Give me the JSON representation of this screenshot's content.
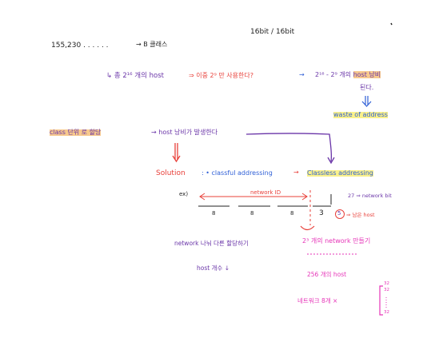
{
  "page": {
    "top_row": {
      "address": "155,230 . . . . . .",
      "b_class": "→ B 클래스",
      "bits": "16bit / 16bit"
    },
    "row_waste": {
      "hook": "↳ 총 2¹⁶ 개의 host",
      "middle": "⇒ 이중 2⁹ 만 사용한다?",
      "result_pre": "2¹⁶ - 2⁹ 개의",
      "result_hl": "host 낭비",
      "result_post": "된다.",
      "waste": "waste of address"
    },
    "row_class": {
      "class_label": "class 단위 로 할당",
      "arrow_text": "→ host 낭비가 발생한다"
    },
    "row_solution": {
      "solution": "Solution",
      "classful": ": • classful addressing",
      "arrow": "→",
      "classless": "Classless addressing"
    },
    "diagram": {
      "a_label": "ex)",
      "network_id": "network ID",
      "octets": [
        "8",
        "8",
        "8",
        "3",
        "5"
      ],
      "bits_27": "27 ⇒ network bit",
      "hosts_note": "⇒ 남은 host",
      "net_count": "2³ 개의 network 만들기"
    },
    "bottom": {
      "network_split": "network 나눠 다른 할당하기",
      "host_count": "host 개수 ↓",
      "hosts_256": "256 개의 host",
      "split_8": "네트워크 8개 ×",
      "bracket_top": "32",
      "bracket_mid": "32",
      "bracket_bottom": "32"
    }
  },
  "colors": {
    "orange_hl": "#f7c98e",
    "yellow_hl": "#faf18a",
    "red": "#e8403a",
    "blue": "#2f5fd6",
    "purple": "#6a35a8",
    "magenta": "#e635b8"
  }
}
